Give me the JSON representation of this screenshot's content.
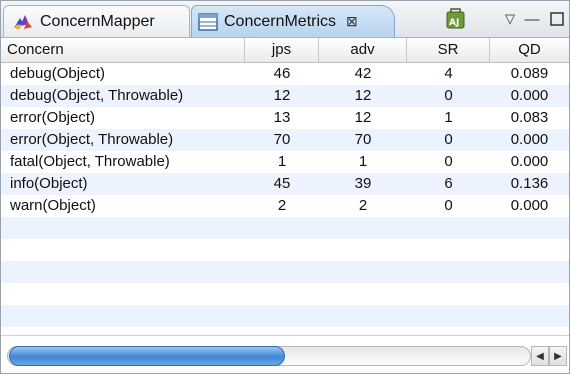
{
  "tabs": [
    {
      "label": "ConcernMapper",
      "active": false
    },
    {
      "label": "ConcernMetrics",
      "active": true
    }
  ],
  "icons": {
    "mapper": "concern-mapper-icon",
    "metrics": "table-view-icon",
    "close": "close-icon",
    "aj": "aspectj-icon",
    "view_menu": "view-menu-icon",
    "minimize": "minimize-icon",
    "maximize": "maximize-icon"
  },
  "glyphs": {
    "close": "⊠",
    "view_menu": "▽",
    "minimize": "—",
    "arrow_left": "◀",
    "arrow_right": "▶"
  },
  "table": {
    "headers": [
      "Concern",
      "jps",
      "adv",
      "SR",
      "QD"
    ],
    "rows": [
      [
        "debug(Object)",
        "46",
        "42",
        "4",
        "0.089"
      ],
      [
        "debug(Object, Throwable)",
        "12",
        "12",
        "0",
        "0.000"
      ],
      [
        "error(Object)",
        "13",
        "12",
        "1",
        "0.083"
      ],
      [
        "error(Object, Throwable)",
        "70",
        "70",
        "0",
        "0.000"
      ],
      [
        "fatal(Object, Throwable)",
        "1",
        "1",
        "0",
        "0.000"
      ],
      [
        "info(Object)",
        "45",
        "39",
        "6",
        "0.136"
      ],
      [
        "warn(Object)",
        "2",
        "2",
        "0",
        "0.000"
      ]
    ],
    "empty_rows": 6
  },
  "colors": {
    "alt_row": "#edf3fe",
    "active_tab": "#b8d3ee",
    "scroll_thumb": "#3f86d4"
  }
}
